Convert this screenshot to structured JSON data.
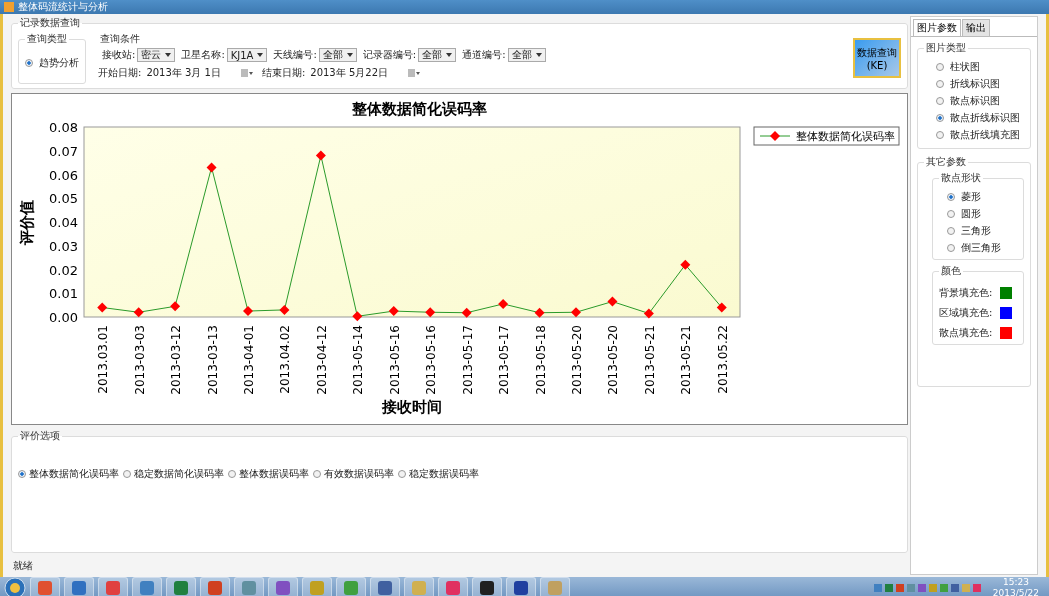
{
  "window": {
    "title": "整体码流统计与分析"
  },
  "query": {
    "title": "记录数据查询",
    "type_group": {
      "title": "查询类型",
      "options": [
        {
          "label": "趋势分析",
          "selected": true
        }
      ]
    },
    "conditions": {
      "title": "查询条件",
      "fields": [
        {
          "label": "接收站:",
          "value": "密云"
        },
        {
          "label": "卫星名称:",
          "value": "KJ1A"
        },
        {
          "label": "天线编号:",
          "value": "全部"
        },
        {
          "label": "记录器编号:",
          "value": "全部"
        },
        {
          "label": "通道编号:",
          "value": "全部"
        }
      ],
      "dates": [
        {
          "label": "开始日期:",
          "value": "2013年 3月 1日"
        },
        {
          "label": "结束日期:",
          "value": "2013年 5月22日"
        }
      ]
    },
    "button": "数据查询(KE)"
  },
  "chart": {
    "chart_data": {
      "type": "line",
      "title": "整体数据简化误码率",
      "xlabel": "接收时间",
      "ylabel": "评价值",
      "categories": [
        "2013.03.01",
        "2013-03-03",
        "2013-03-12",
        "2013-03-13",
        "2013-04-01",
        "2013.04.02",
        "2013-04-12",
        "2013-05-14",
        "2013-05-16",
        "2013-05-16",
        "2013-05-17",
        "2013-05-17",
        "2013-05-18",
        "2013-05-20",
        "2013-05-20",
        "2013-05-21",
        "2013-05-21",
        "2013.05.22"
      ],
      "series": [
        {
          "name": "整体数据简化误码率",
          "color": "#ff0000",
          "marker": "diamond",
          "values": [
            0.004,
            0.002,
            0.0045,
            0.063,
            0.0025,
            0.003,
            0.068,
            0.0003,
            0.0025,
            0.002,
            0.0018,
            0.0055,
            0.0018,
            0.002,
            0.0065,
            0.0015,
            0.022,
            0.004
          ]
        }
      ],
      "ylim": [
        0,
        0.08
      ],
      "yticks": [
        {
          "value": 0,
          "label": "0.00"
        },
        {
          "value": 0.01,
          "label": "0.01"
        },
        {
          "value": 0.02,
          "label": "0.02"
        },
        {
          "value": 0.03,
          "label": "0.03"
        },
        {
          "value": 0.04,
          "label": "0.04"
        },
        {
          "value": 0.05,
          "label": "0.05"
        },
        {
          "value": 0.06,
          "label": "0.06"
        },
        {
          "value": 0.07,
          "label": "0.07"
        },
        {
          "value": 0.08,
          "label": "0.08"
        }
      ]
    }
  },
  "evaluation": {
    "title": "评价选项",
    "options": [
      {
        "label": "整体数据简化误码率",
        "selected": true
      },
      {
        "label": "稳定数据简化误码率",
        "selected": false
      },
      {
        "label": "整体数据误码率",
        "selected": false
      },
      {
        "label": "有效数据误码率",
        "selected": false
      },
      {
        "label": "稳定数据误码率",
        "selected": false
      }
    ]
  },
  "status_bar": "就绪",
  "side": {
    "tabs": [
      {
        "label": "图片参数",
        "selected": true
      },
      {
        "label": "输出",
        "selected": false
      }
    ],
    "chart_type": {
      "title": "图片类型",
      "options": [
        {
          "label": "柱状图",
          "selected": false
        },
        {
          "label": "折线标识图",
          "selected": false
        },
        {
          "label": "散点标识图",
          "selected": false
        },
        {
          "label": "散点折线标识图",
          "selected": true
        },
        {
          "label": "散点折线填充图",
          "selected": false
        }
      ]
    },
    "other": {
      "title": "其它参数",
      "shape": {
        "title": "散点形状",
        "options": [
          {
            "label": "菱形",
            "selected": true
          },
          {
            "label": "圆形",
            "selected": false
          },
          {
            "label": "三角形",
            "selected": false
          },
          {
            "label": "倒三角形",
            "selected": false
          }
        ]
      },
      "colors": {
        "title": "颜色",
        "items": [
          {
            "label": "背景填充色:",
            "color": "#008000"
          },
          {
            "label": "区域填充色:",
            "color": "#0000ff"
          },
          {
            "label": "散点填充色:",
            "color": "#ff0000"
          }
        ]
      }
    }
  },
  "taskbar": {
    "time": "15:23",
    "date": "2013/5/22"
  }
}
